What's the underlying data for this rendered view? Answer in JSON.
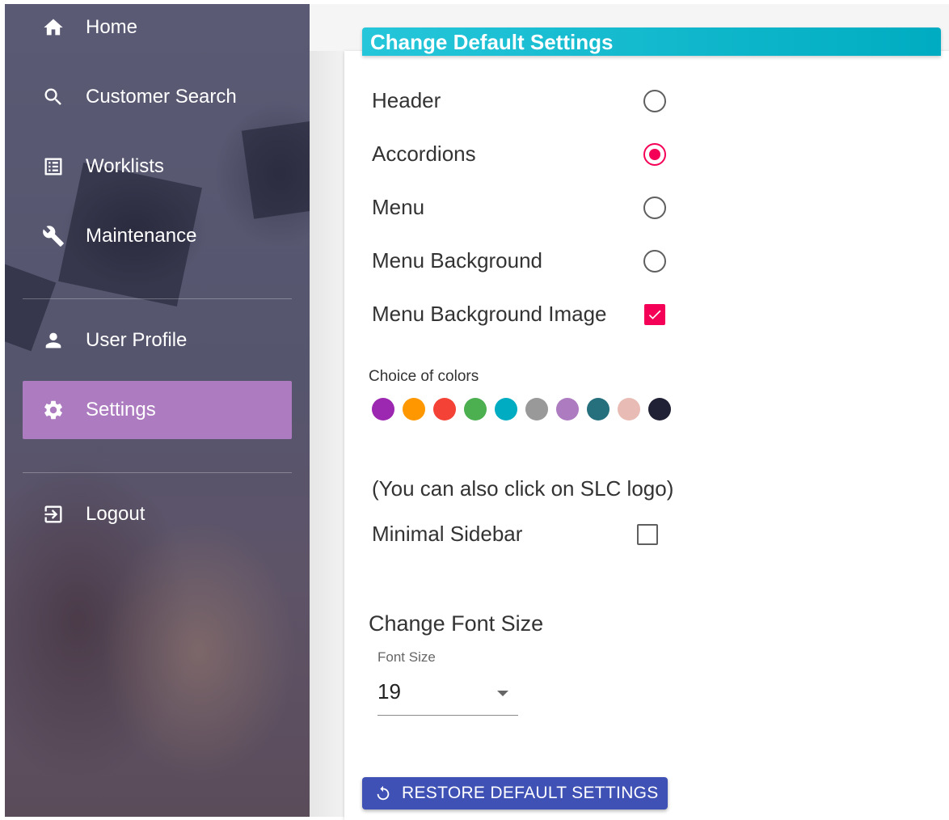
{
  "sidebar": {
    "items": [
      {
        "label": "Home",
        "icon": "home-icon"
      },
      {
        "label": "Customer Search",
        "icon": "search-icon"
      },
      {
        "label": "Worklists",
        "icon": "list-icon"
      },
      {
        "label": "Maintenance",
        "icon": "wrench-icon"
      },
      {
        "label": "User Profile",
        "icon": "person-icon"
      },
      {
        "label": "Settings",
        "icon": "gear-icon",
        "active": true
      },
      {
        "label": "Logout",
        "icon": "logout-icon"
      }
    ],
    "active_color": "#ad7bc0"
  },
  "settings": {
    "title": "Change Default Settings",
    "options": [
      {
        "label": "Header",
        "type": "radio",
        "checked": false
      },
      {
        "label": "Accordions",
        "type": "radio",
        "checked": true
      },
      {
        "label": "Menu",
        "type": "radio",
        "checked": false
      },
      {
        "label": "Menu Background",
        "type": "radio",
        "checked": false
      },
      {
        "label": "Menu Background Image",
        "type": "checkbox",
        "checked": true
      }
    ],
    "colors_label": "Choice of colors",
    "colors": [
      "#9c27b0",
      "#ff9800",
      "#f44336",
      "#4caf50",
      "#00acc1",
      "#999999",
      "#ad7bc0",
      "#26707d",
      "#e8bcb4",
      "#212135"
    ],
    "note": "(You can also click on SLC logo)",
    "minimal_sidebar": {
      "label": "Minimal Sidebar",
      "checked": false
    },
    "font_section_title": "Change Font Size",
    "font_size_label": "Font Size",
    "font_size_value": "19",
    "restore_label": "RESTORE DEFAULT SETTINGS"
  },
  "theme": {
    "header_color": "#00acc1",
    "accent": "#f50057",
    "button_color": "#3f51b5"
  }
}
